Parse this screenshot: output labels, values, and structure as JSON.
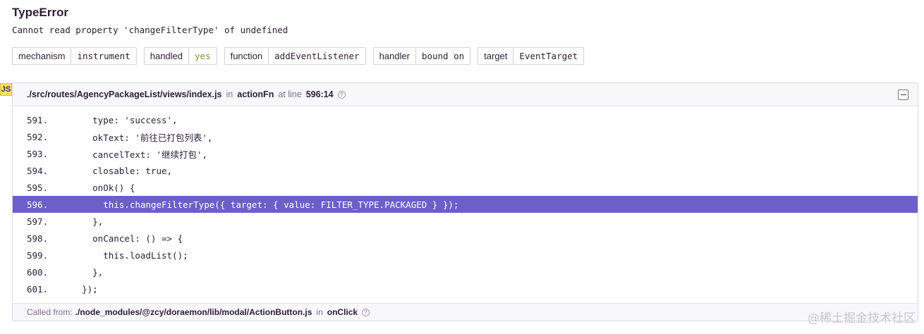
{
  "error": {
    "title": "TypeError",
    "message": "Cannot read property 'changeFilterType' of undefined"
  },
  "tags": [
    {
      "key": "mechanism",
      "value": "instrument"
    },
    {
      "key": "handled",
      "value": "yes"
    },
    {
      "key": "function",
      "value": "addEventListener"
    },
    {
      "key": "handler",
      "value": "bound on"
    },
    {
      "key": "target",
      "value": "EventTarget"
    }
  ],
  "frame": {
    "badge": "JS",
    "file": "./src/routes/AgencyPackageList/views/index.js",
    "in_word": "in",
    "function": "actionFn",
    "at_line_word": "at line",
    "location": "596:14",
    "help_icon": "?",
    "lines": [
      {
        "num": "591.",
        "code": "      type: 'success',"
      },
      {
        "num": "592.",
        "code": "      okText: '前往已打包列表',"
      },
      {
        "num": "593.",
        "code": "      cancelText: '继续打包',"
      },
      {
        "num": "594.",
        "code": "      closable: true,"
      },
      {
        "num": "595.",
        "code": "      onOk() {"
      },
      {
        "num": "596.",
        "code": "        this.changeFilterType({ target: { value: FILTER_TYPE.PACKAGED } });"
      },
      {
        "num": "597.",
        "code": "      },"
      },
      {
        "num": "598.",
        "code": "      onCancel: () => {"
      },
      {
        "num": "599.",
        "code": "        this.loadList();"
      },
      {
        "num": "600.",
        "code": "      },"
      },
      {
        "num": "601.",
        "code": "    });"
      }
    ],
    "active_line": "596.",
    "footer": {
      "prefix": "Called from:",
      "file": "./node_modules/@zcy/doraemon/lib/modal/ActionButton.js",
      "in_word": "in",
      "function": "onClick",
      "help_icon": "?"
    }
  },
  "watermark": "@稀土掘金技术社区",
  "colors": {
    "accent": "#6c5fc7",
    "js_badge": "#f7df5a",
    "handled_yes": "#8a8f3a"
  }
}
